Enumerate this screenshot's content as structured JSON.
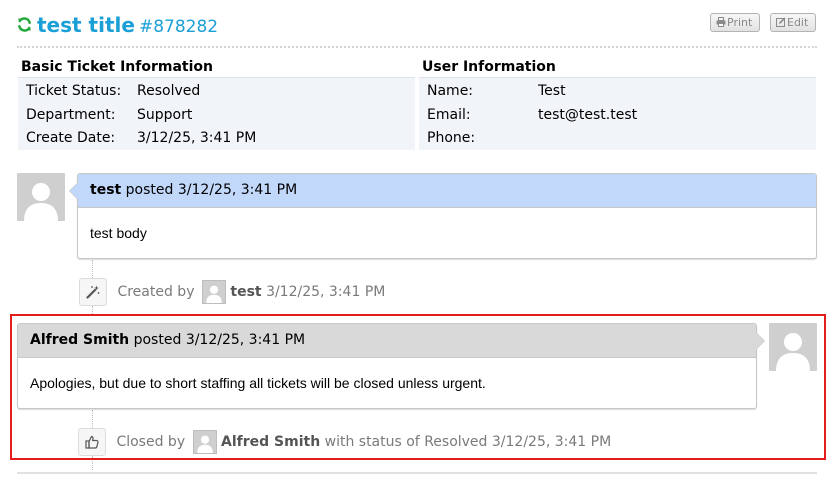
{
  "header": {
    "refresh_icon": "refresh-icon",
    "title": "test title",
    "number": "#878282",
    "print_label": "Print",
    "print_icon": "print-icon",
    "edit_label": "Edit",
    "edit_icon": "edit-icon"
  },
  "ticket_info": {
    "heading": "Basic Ticket Information",
    "status_label": "Ticket Status:",
    "status_value": "Resolved",
    "department_label": "Department:",
    "department_value": "Support",
    "create_date_label": "Create Date:",
    "create_date_value": "3/12/25, 3:41 PM"
  },
  "user_info": {
    "heading": "User Information",
    "name_label": "Name:",
    "name_value": "Test",
    "email_label": "Email:",
    "email_value": "test@test.test",
    "phone_label": "Phone:",
    "phone_value": ""
  },
  "thread": [
    {
      "author": "test",
      "posted_text": "posted",
      "timestamp": "3/12/25, 3:41 PM",
      "body": "test body",
      "header_color": "#c2d8fb"
    },
    {
      "author": "Alfred Smith",
      "posted_text": "posted",
      "timestamp": "3/12/25, 3:41 PM",
      "body": "Apologies, but due to short staffing all tickets will be closed unless urgent.",
      "header_color": "#d9d9d9"
    }
  ],
  "events": [
    {
      "icon": "magic-wand-icon",
      "prefix": "Created by",
      "user": "test",
      "suffix": "",
      "timestamp": "3/12/25, 3:41 PM"
    },
    {
      "icon": "thumbs-up-icon",
      "prefix": "Closed by",
      "user": "Alfred Smith",
      "suffix": "with status of Resolved",
      "timestamp": "3/12/25, 3:41 PM"
    }
  ],
  "colors": {
    "title": "#1a9fd6",
    "refresh_icon": "#22a83a",
    "highlight": "#e31c1c"
  }
}
